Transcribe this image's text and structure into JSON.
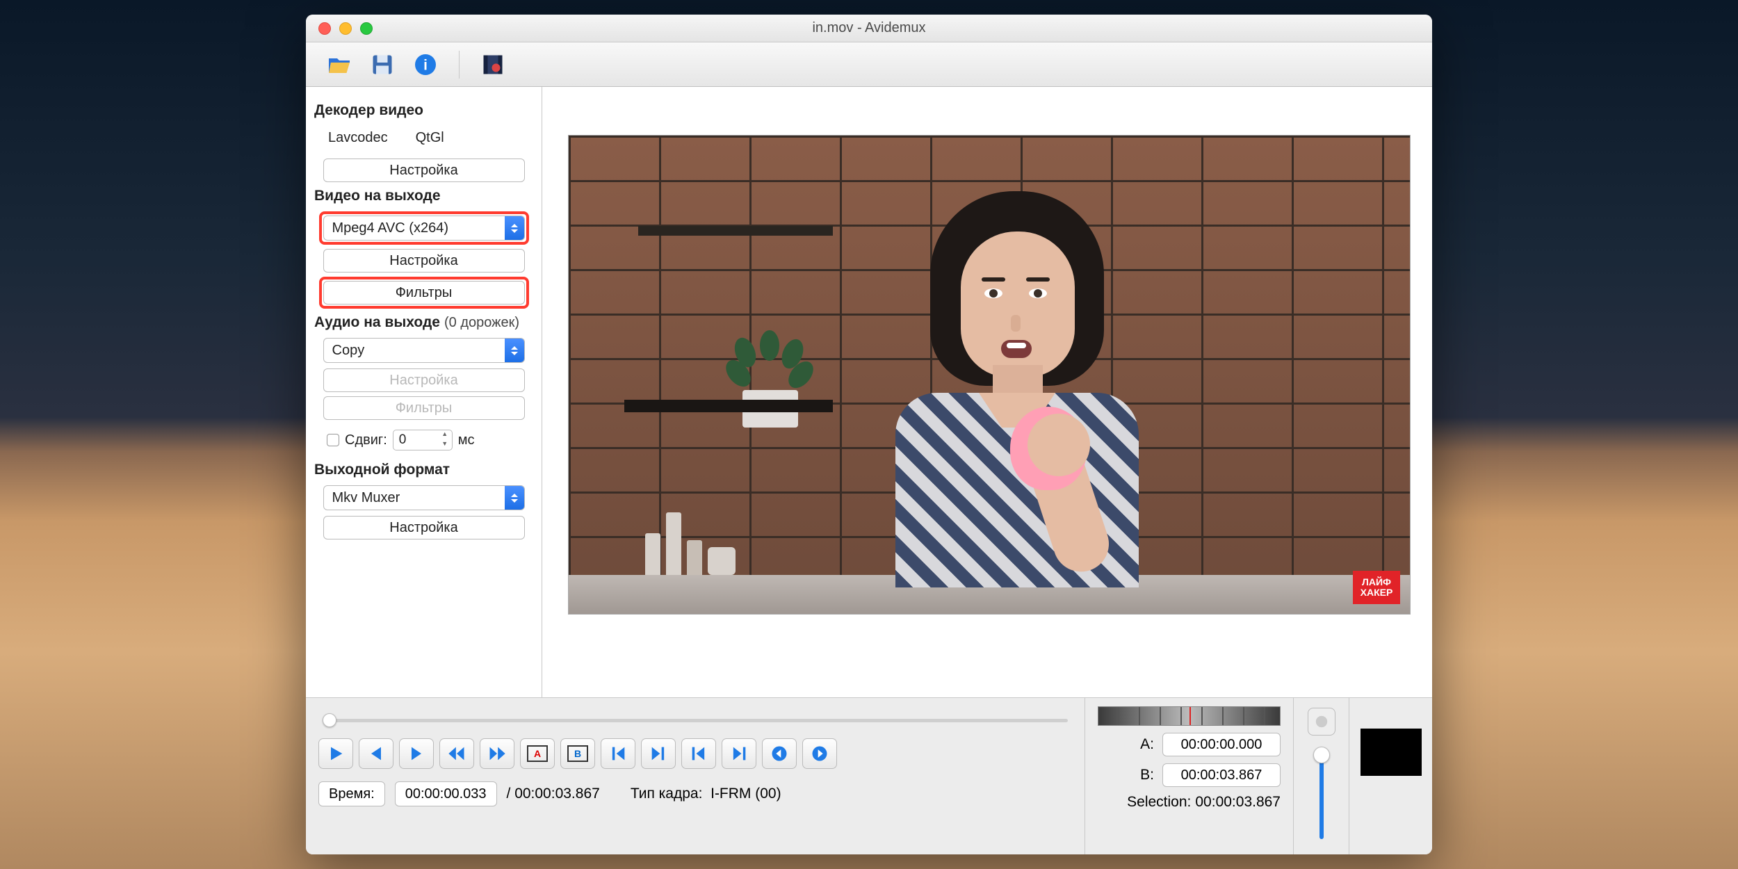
{
  "window": {
    "title": "in.mov - Avidemux"
  },
  "toolbar_icons": [
    "open-icon",
    "save-icon",
    "info-icon",
    "filters-icon"
  ],
  "sidebar": {
    "decoder_header": "Декодер видео",
    "decoder_sub1": "Lavcodec",
    "decoder_sub2": "QtGl",
    "decoder_config_btn": "Настройка",
    "video_out_header": "Видео на выходе",
    "video_codec": "Mpeg4 AVC (x264)",
    "video_config_btn": "Настройка",
    "video_filters_btn": "Фильтры",
    "audio_out_header": "Аудио на выходе",
    "audio_tracks_note": "(0 дорожек)",
    "audio_codec": "Copy",
    "audio_config_btn": "Настройка",
    "audio_filters_btn": "Фильтры",
    "shift_label": "Сдвиг:",
    "shift_value": "0",
    "shift_unit": "мс",
    "format_header": "Выходной формат",
    "muxer": "Mkv Muxer",
    "muxer_config_btn": "Настройка"
  },
  "badge": {
    "line1": "ЛАЙФ",
    "line2": "ХАКЕР"
  },
  "transport": {
    "time_label": "Время:",
    "time_value": "00:00:00.033",
    "duration": "00:00:03.867",
    "frame_type_label": "Тип кадра:",
    "frame_type_value": "I-FRM (00)"
  },
  "selection": {
    "a_label": "A:",
    "a_value": "00:00:00.000",
    "b_label": "B:",
    "b_value": "00:00:03.867",
    "sel_label": "Selection:",
    "sel_value": "00:00:03.867"
  }
}
